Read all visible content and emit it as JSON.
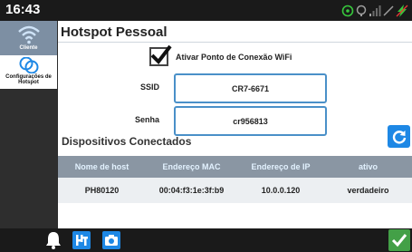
{
  "status": {
    "time": "16:43"
  },
  "sidebar": {
    "items": [
      {
        "label": "Cliente",
        "active": true
      },
      {
        "label": "Configurações de Hotspot",
        "active": false
      }
    ]
  },
  "main": {
    "title": "Hotspot Pessoal",
    "enable_label": "Ativar Ponto de Conexão WiFi",
    "enable_checked": true,
    "ssid_label": "SSID",
    "ssid_value": "CR7-6671",
    "password_label": "Senha",
    "password_value": "cr956813",
    "devices_title": "Dispositivos Conectados",
    "table": {
      "headers": [
        "Nome de host",
        "Endereço MAC",
        "Endereço de IP",
        "ativo"
      ],
      "rows": [
        [
          "PH80120",
          "00:04:f3:1e:3f:b9",
          "10.0.0.120",
          "verdadeiro"
        ]
      ]
    }
  },
  "colors": {
    "accent": "#1e88e5",
    "sidebar_active": "#7d8fa3",
    "table_header": "#8a96a3",
    "ok_green": "#43a047",
    "status_green": "#37c83c"
  },
  "icons": {
    "status": [
      "gps-icon",
      "sim-icon",
      "signal-icon",
      "no-data-icon",
      "charging-icon"
    ],
    "sidebar": [
      "wifi-icon",
      "hotspot-icon"
    ],
    "bottom": [
      "bell-icon",
      "phone-input-icon",
      "camera-icon",
      "checkmark-icon"
    ]
  }
}
